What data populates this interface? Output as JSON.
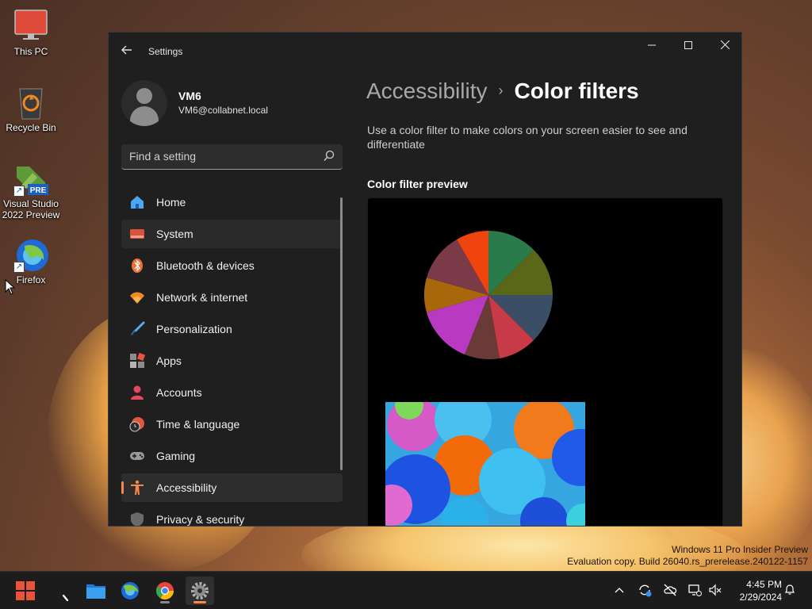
{
  "desktop": {
    "icons": [
      {
        "label": "This PC"
      },
      {
        "label": "Recycle Bin"
      },
      {
        "label": "Visual Studio\n2022 Preview",
        "badge": "PRE"
      },
      {
        "label": "Firefox"
      }
    ],
    "watermark": {
      "line1": "Windows 11 Pro Insider Preview",
      "line2": "Evaluation copy. Build 26040.rs_prerelease.240122-1157"
    }
  },
  "window": {
    "title": "Settings",
    "controls": {
      "minimize": "─",
      "maximize": "☐",
      "close": "✕"
    },
    "user": {
      "name": "VM6",
      "email": "VM6@collabnet.local"
    },
    "search": {
      "placeholder": "Find a setting"
    },
    "nav": [
      {
        "label": "Home",
        "icon": "home-icon"
      },
      {
        "label": "System",
        "icon": "system-icon"
      },
      {
        "label": "Bluetooth & devices",
        "icon": "bluetooth-icon"
      },
      {
        "label": "Network & internet",
        "icon": "wifi-icon"
      },
      {
        "label": "Personalization",
        "icon": "brush-icon"
      },
      {
        "label": "Apps",
        "icon": "apps-icon"
      },
      {
        "label": "Accounts",
        "icon": "person-icon"
      },
      {
        "label": "Time & language",
        "icon": "clock-globe-icon"
      },
      {
        "label": "Gaming",
        "icon": "gamepad-icon"
      },
      {
        "label": "Accessibility",
        "icon": "accessibility-icon",
        "selected": true
      },
      {
        "label": "Privacy & security",
        "icon": "shield-icon"
      }
    ],
    "breadcrumb": {
      "parent": "Accessibility",
      "separator": "›",
      "current": "Color filters"
    },
    "description": "Use a color filter to make colors on your screen easier to see and differentiate",
    "preview_heading": "Color filter preview",
    "accent_color": "#f7874a"
  },
  "taskbar": {
    "apps": [
      "start-icon",
      "search-icon",
      "file-explorer-icon",
      "firefox-icon",
      "chrome-icon",
      "settings-icon"
    ],
    "clock": {
      "time": "4:45 PM",
      "date": "2/29/2024"
    }
  }
}
